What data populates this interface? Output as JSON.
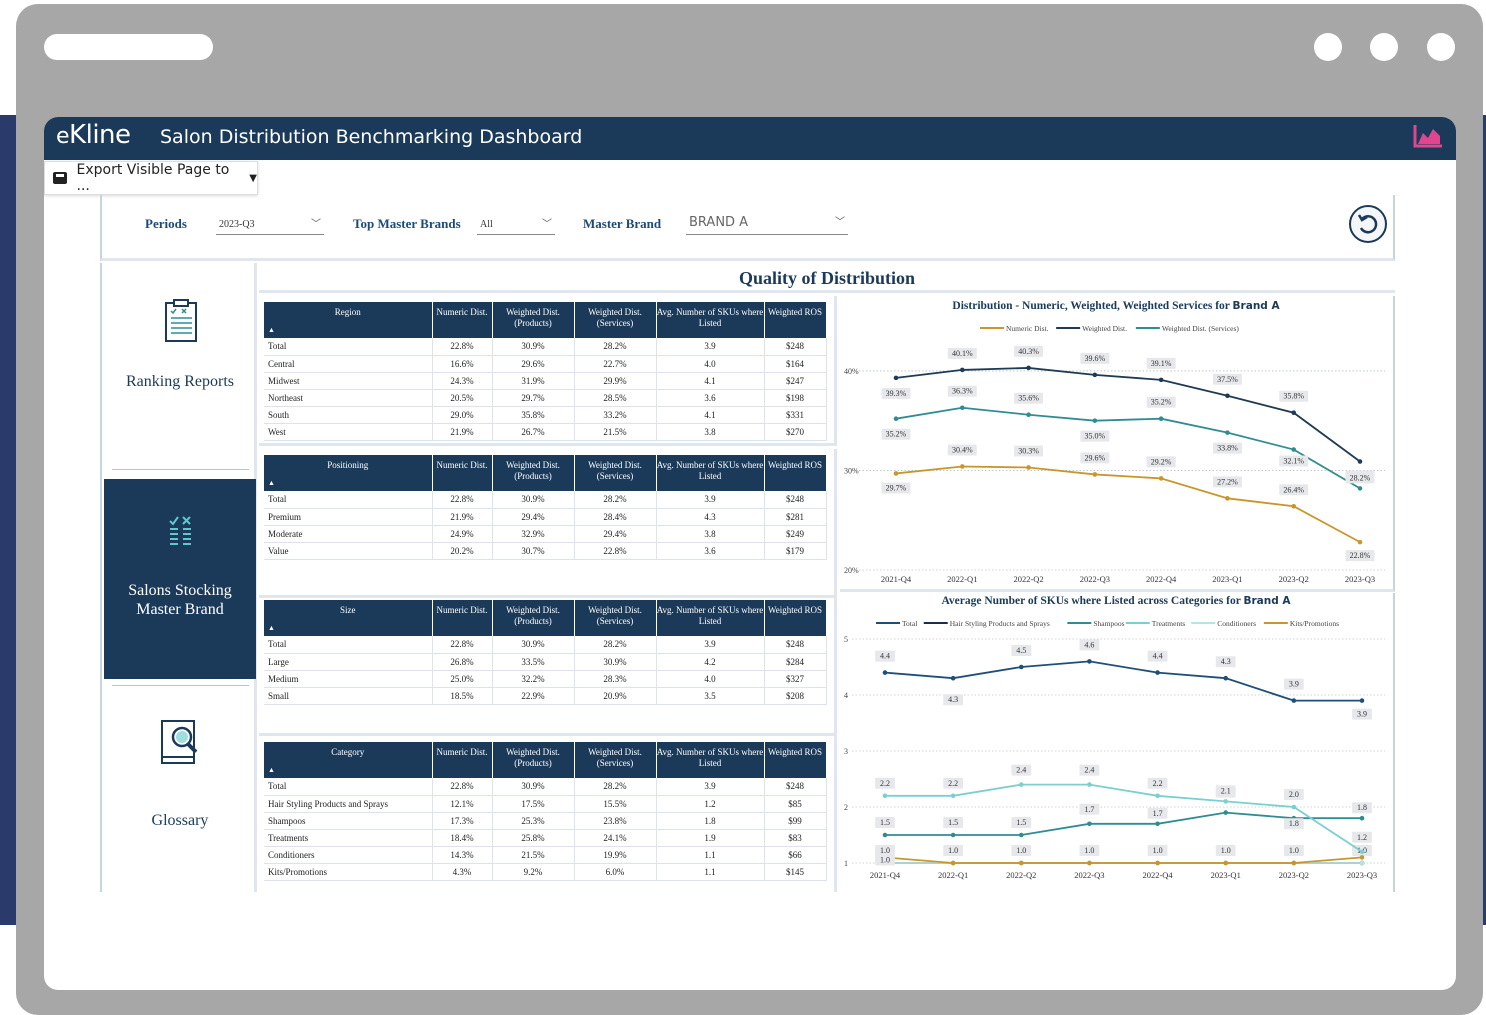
{
  "app": {
    "logo": "Kline",
    "title": "Salon Distribution Benchmarking Dashboard",
    "export_label": "Export Visible Page to ..."
  },
  "filters": {
    "periods_label": "Periods",
    "periods_value": "2023-Q3",
    "top_brands_label": "Top Master Brands",
    "top_brands_value": "All",
    "master_brand_label": "Master Brand",
    "master_brand_value": "BRAND A"
  },
  "nav": {
    "ranking": "Ranking Reports",
    "salons_line1": "Salons Stocking",
    "salons_line2": "Master Brand",
    "glossary": "Glossary"
  },
  "section_title": "Quality of Distribution",
  "table_headers": [
    "Numeric Dist.",
    "Weighted Dist. (Products)",
    "Weighted Dist. (Services)",
    "Avg. Number of SKUs where Listed",
    "Weighted ROS"
  ],
  "tables": [
    {
      "title": "Region",
      "rows": [
        [
          "Total",
          "22.8%",
          "30.9%",
          "28.2%",
          "3.9",
          "$248"
        ],
        [
          "Central",
          "16.6%",
          "29.6%",
          "22.7%",
          "4.0",
          "$164"
        ],
        [
          "Midwest",
          "24.3%",
          "31.9%",
          "29.9%",
          "4.1",
          "$247"
        ],
        [
          "Northeast",
          "20.5%",
          "29.7%",
          "28.5%",
          "3.6",
          "$198"
        ],
        [
          "South",
          "29.0%",
          "35.8%",
          "33.2%",
          "4.1",
          "$331"
        ],
        [
          "West",
          "21.9%",
          "26.7%",
          "21.5%",
          "3.8",
          "$270"
        ]
      ]
    },
    {
      "title": "Positioning",
      "rows": [
        [
          "Total",
          "22.8%",
          "30.9%",
          "28.2%",
          "3.9",
          "$248"
        ],
        [
          "Premium",
          "21.9%",
          "29.4%",
          "28.4%",
          "4.3",
          "$281"
        ],
        [
          "Moderate",
          "24.9%",
          "32.9%",
          "29.4%",
          "3.8",
          "$249"
        ],
        [
          "Value",
          "20.2%",
          "30.7%",
          "22.8%",
          "3.6",
          "$179"
        ]
      ]
    },
    {
      "title": "Size",
      "rows": [
        [
          "Total",
          "22.8%",
          "30.9%",
          "28.2%",
          "3.9",
          "$248"
        ],
        [
          "Large",
          "26.8%",
          "33.5%",
          "30.9%",
          "4.2",
          "$284"
        ],
        [
          "Medium",
          "25.0%",
          "32.2%",
          "28.3%",
          "4.0",
          "$327"
        ],
        [
          "Small",
          "18.5%",
          "22.9%",
          "20.9%",
          "3.5",
          "$208"
        ]
      ]
    },
    {
      "title": "Category",
      "rows": [
        [
          "Total",
          "22.8%",
          "30.9%",
          "28.2%",
          "3.9",
          "$248"
        ],
        [
          "Hair Styling Products and Sprays",
          "12.1%",
          "17.5%",
          "15.5%",
          "1.2",
          "$85"
        ],
        [
          "Shampoos",
          "17.3%",
          "25.3%",
          "23.8%",
          "1.8",
          "$99"
        ],
        [
          "Treatments",
          "18.4%",
          "25.8%",
          "24.1%",
          "1.9",
          "$83"
        ],
        [
          "Conditioners",
          "14.3%",
          "21.5%",
          "19.9%",
          "1.1",
          "$66"
        ],
        [
          "Kits/Promotions",
          "4.3%",
          "9.2%",
          "6.0%",
          "1.1",
          "$145"
        ]
      ]
    }
  ],
  "chart_data": [
    {
      "type": "line",
      "title": "Distribution - Numeric, Weighted, Weighted Services for",
      "title_brand": "Brand A",
      "x": [
        "2021-Q4",
        "2022-Q1",
        "2022-Q2",
        "2022-Q3",
        "2022-Q4",
        "2023-Q1",
        "2023-Q2",
        "2023-Q3"
      ],
      "y_ticks": [
        "20%",
        "30%",
        "40%"
      ],
      "ylim": [
        20,
        42
      ],
      "legend_position": "top",
      "series": [
        {
          "name": "Numeric Dist.",
          "color": "#c9962c",
          "values": [
            29.7,
            30.4,
            30.3,
            29.6,
            29.2,
            27.2,
            26.4,
            22.8
          ],
          "labels": [
            "29.7%",
            "30.4%",
            "30.3%",
            "29.6%",
            "29.2%",
            "27.2%",
            "26.4%",
            "22.8%"
          ]
        },
        {
          "name": "Weighted Dist.",
          "color": "#1e3a55",
          "values": [
            39.3,
            40.1,
            40.3,
            39.6,
            39.1,
            37.5,
            35.8,
            30.9
          ],
          "labels": [
            "39.3%",
            "40.1%",
            "40.3%",
            "39.6%",
            "39.1%",
            "37.5%",
            "35.8%",
            "30.9%"
          ]
        },
        {
          "name": "Weighted Dist. (Services)",
          "color": "#2f8d92",
          "values": [
            35.2,
            36.3,
            35.6,
            35.0,
            35.2,
            33.8,
            32.1,
            28.2
          ],
          "labels": [
            "35.2%",
            "36.3%",
            "35.6%",
            "35.0%",
            "35.2%",
            "33.8%",
            "32.1%",
            "28.2%"
          ]
        }
      ]
    },
    {
      "type": "line",
      "title": "Average Number of SKUs where Listed across Categories for",
      "title_brand": "Brand A",
      "x": [
        "2021-Q4",
        "2022-Q1",
        "2022-Q2",
        "2022-Q3",
        "2022-Q4",
        "2023-Q1",
        "2023-Q2",
        "2023-Q3"
      ],
      "y_ticks": [
        "1",
        "2",
        "3",
        "4",
        "5"
      ],
      "ylim": [
        1,
        5
      ],
      "legend_position": "top",
      "series": [
        {
          "name": "Total",
          "color": "#1f4f79",
          "values": [
            4.4,
            4.3,
            4.5,
            4.6,
            4.4,
            4.3,
            3.9,
            3.9
          ],
          "labels": [
            "4.4",
            "4.3",
            "4.5",
            "4.6",
            "4.4",
            "4.3",
            "3.9",
            "3.9"
          ]
        },
        {
          "name": "Hair Styling Products and Sprays",
          "color": "#1e2e4a",
          "values": [
            1.0,
            1.0,
            1.0,
            1.0,
            1.0,
            1.0,
            1.0,
            1.0
          ],
          "labels": [
            "1.0",
            "1.0",
            "1.0",
            "1.0",
            "1.0",
            "1.0",
            "1.0",
            "1.0"
          ]
        },
        {
          "name": "Shampoos",
          "color": "#2f8d92",
          "values": [
            1.5,
            1.5,
            1.5,
            1.7,
            1.7,
            1.9,
            1.8,
            1.8
          ],
          "labels": [
            "1.5",
            "1.5",
            "1.5",
            "1.7",
            "1.7",
            "1.9",
            "1.8",
            "1.8"
          ]
        },
        {
          "name": "Treatments",
          "color": "#7ccfcf",
          "values": [
            2.2,
            2.2,
            2.4,
            2.4,
            2.2,
            2.1,
            2.0,
            1.2
          ],
          "labels": [
            "2.2",
            "2.2",
            "2.4",
            "2.4",
            "2.2",
            "2.1",
            "2.0",
            "1.2"
          ]
        },
        {
          "name": "Conditioners",
          "color": "#b6e3e3",
          "values": [
            1.0,
            1.0,
            1.0,
            1.0,
            1.0,
            1.0,
            1.0,
            1.0
          ],
          "labels": []
        },
        {
          "name": "Kits/Promotions",
          "color": "#c9962c",
          "values": [
            1.1,
            1.0,
            1.0,
            1.0,
            1.0,
            1.0,
            1.0,
            1.1
          ],
          "labels": [
            "1.0",
            "",
            "",
            "",
            "",
            "",
            "",
            ""
          ]
        }
      ]
    }
  ]
}
